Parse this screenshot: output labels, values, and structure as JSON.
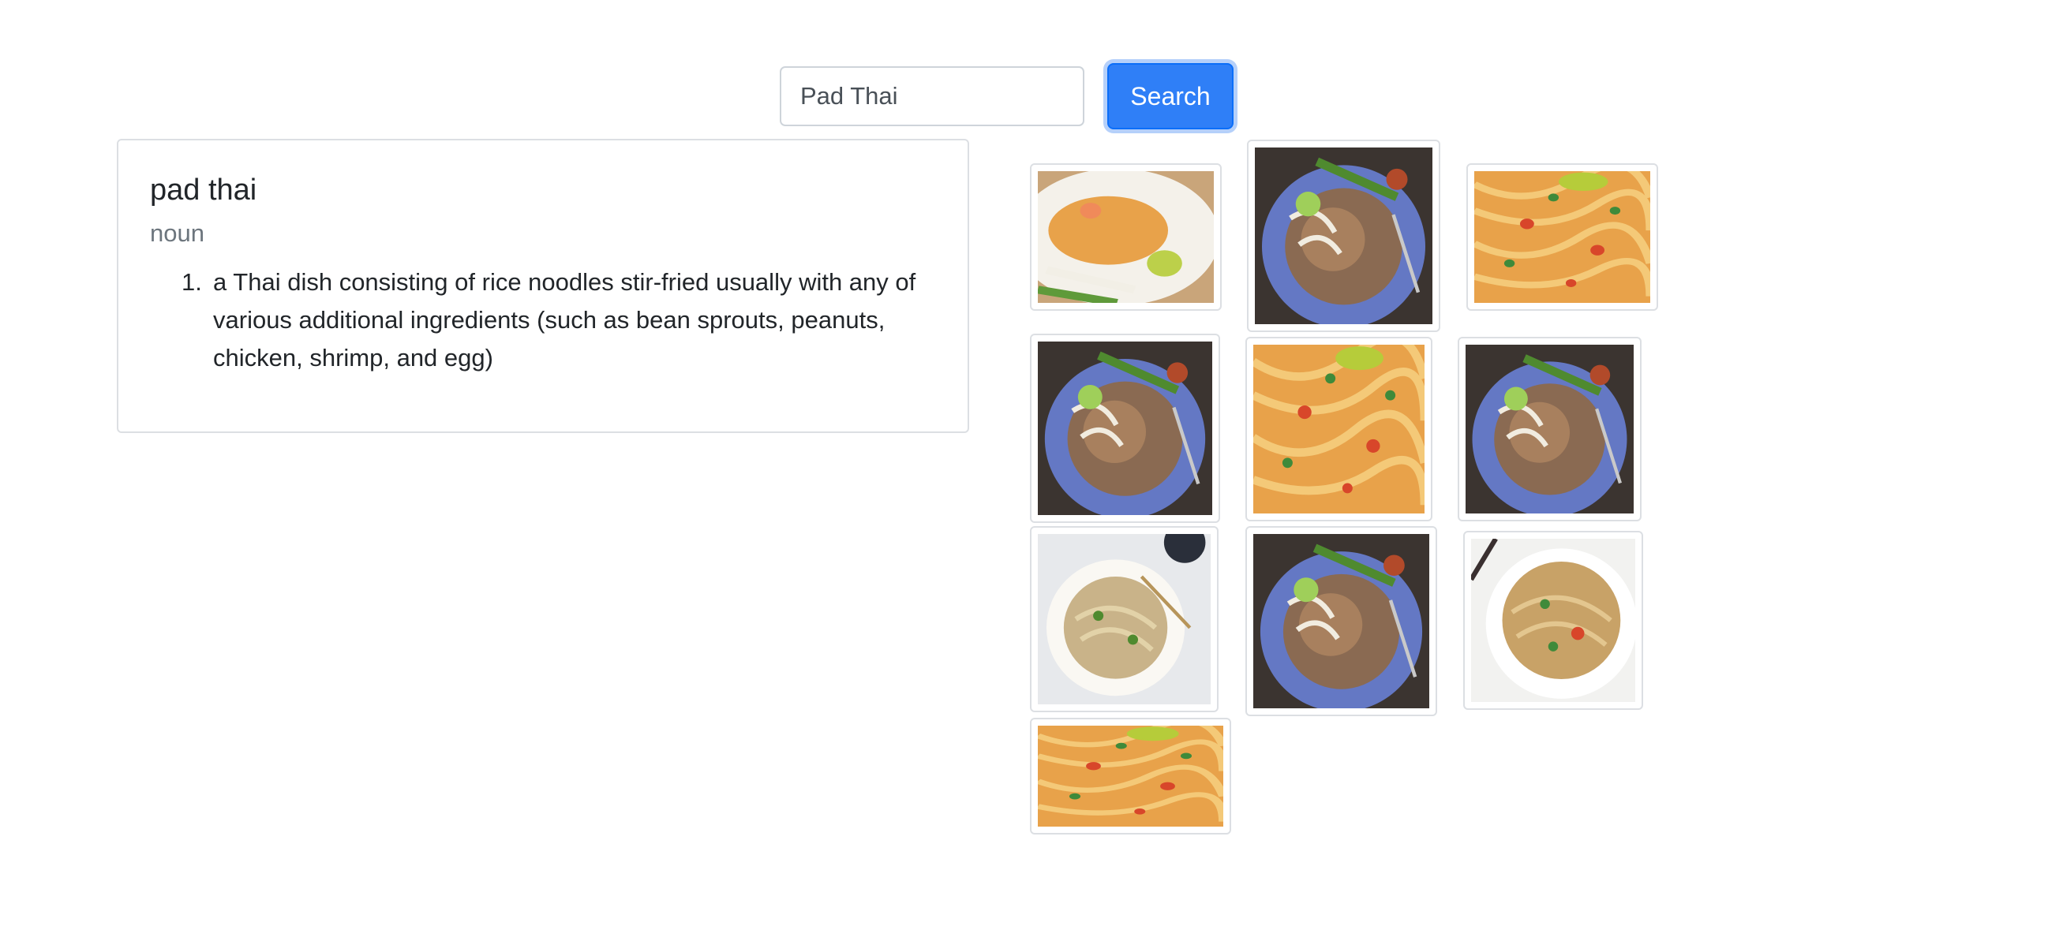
{
  "search": {
    "value": "Pad Thai",
    "button_label": "Search"
  },
  "definition": {
    "word": "pad thai",
    "part_of_speech": "noun",
    "senses": [
      {
        "number": "1.",
        "text": "a Thai dish consisting of rice noodles stir-fried usually with any of various additional ingredients (such as bean sprouts, peanuts, chicken, shrimp, and egg)"
      }
    ]
  },
  "images": [
    {
      "icon": "pad-thai-plate-with-lime-photo",
      "variant": "plate-lime"
    },
    {
      "icon": "pad-thai-blue-plate-photo",
      "variant": "blue-plate"
    },
    {
      "icon": "pad-thai-noodles-closeup-photo",
      "variant": "noodles-closeup"
    },
    {
      "icon": "pad-thai-blue-plate-photo",
      "variant": "blue-plate"
    },
    {
      "icon": "pad-thai-noodles-closeup-photo",
      "variant": "noodles-closeup"
    },
    {
      "icon": "pad-thai-blue-plate-photo",
      "variant": "blue-plate"
    },
    {
      "icon": "pad-thai-white-plate-photo",
      "variant": "white-plate"
    },
    {
      "icon": "pad-thai-blue-plate-photo",
      "variant": "blue-plate"
    },
    {
      "icon": "pad-thai-bowl-photo",
      "variant": "white-bowl"
    },
    {
      "icon": "pad-thai-noodles-closeup-photo",
      "variant": "noodles-closeup"
    }
  ],
  "colors": {
    "accent": "#2f7ff7",
    "muted_text": "#6c757d",
    "border": "#dcdfe3"
  }
}
